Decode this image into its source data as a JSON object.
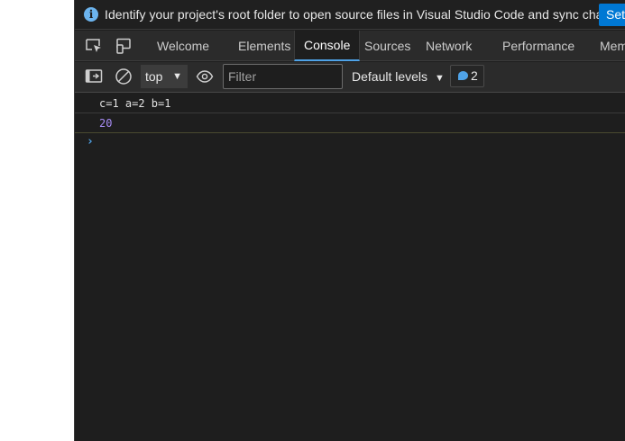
{
  "infobar": {
    "message": "Identify your project's root folder to open source files in Visual Studio Code and sync changes.",
    "action_label": "Set r"
  },
  "tabs": [
    {
      "label": "Welcome",
      "active": false
    },
    {
      "label": "Elements",
      "active": false
    },
    {
      "label": "Console",
      "active": true
    },
    {
      "label": "Sources",
      "active": false
    },
    {
      "label": "Network",
      "active": false
    },
    {
      "label": "Performance",
      "active": false
    },
    {
      "label": "Mem",
      "active": false
    }
  ],
  "toolbar": {
    "context": "top",
    "filter_placeholder": "Filter",
    "levels": "Default levels",
    "issues_count": "2"
  },
  "console": {
    "lines": [
      "c=1 a=2 b=1",
      "20"
    ],
    "prompt": "›"
  },
  "colors": {
    "accent": "#4fa3e8",
    "number": "#a78cf4",
    "info_button": "#0078d4"
  },
  "icons": [
    "info-icon",
    "inspect-element-icon",
    "device-toolbar-icon",
    "sidebar-toggle-icon",
    "clear-console-icon",
    "eye-icon",
    "dropdown-arrow-icon",
    "issues-bubble-icon",
    "prompt-chevron-icon"
  ]
}
